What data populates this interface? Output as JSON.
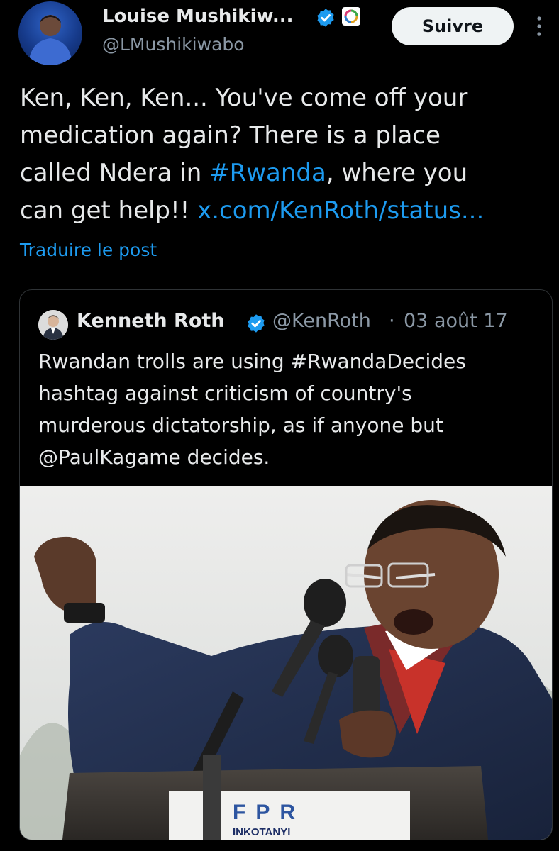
{
  "post": {
    "author_name": "Louise Mushikiw...",
    "author_handle": "@LMushikiwabo",
    "follow_label": "Suivre",
    "text": {
      "line1": "Ken, Ken, Ken... You've come off your",
      "line2": "medication again? There is a place",
      "line3_pre": "called Ndera in ",
      "line3_hashtag": "#Rwanda",
      "line3_post": ", where you",
      "line4_pre": "can get help!! ",
      "line4_link": "x.com/KenRoth/status..."
    },
    "translate_label": "Traduire le post"
  },
  "quote": {
    "author_name": "Kenneth Roth",
    "author_handle": "@KenRoth",
    "separator": "·",
    "date": "03 août 17",
    "text": {
      "line1": "Rwandan trolls are using #RwandaDecides",
      "line2": "hashtag against criticism of country's",
      "line3": "murderous dictatorship, as if anyone but",
      "line4": "@PaulKagame decides."
    },
    "image": {
      "podium_text_main": "FPR",
      "podium_text_sub": "INKOTANYI"
    }
  },
  "colors": {
    "background": "#000000",
    "text_primary": "#e7e9ea",
    "text_secondary": "#8b98a5",
    "link": "#1d9bf0",
    "verified": "#1d9bf0",
    "follow_button_bg": "#eff3f4"
  },
  "icons": {
    "verified": "verified-check-icon",
    "affiliation": "affiliation-badge-icon",
    "more": "more-vertical-icon"
  }
}
